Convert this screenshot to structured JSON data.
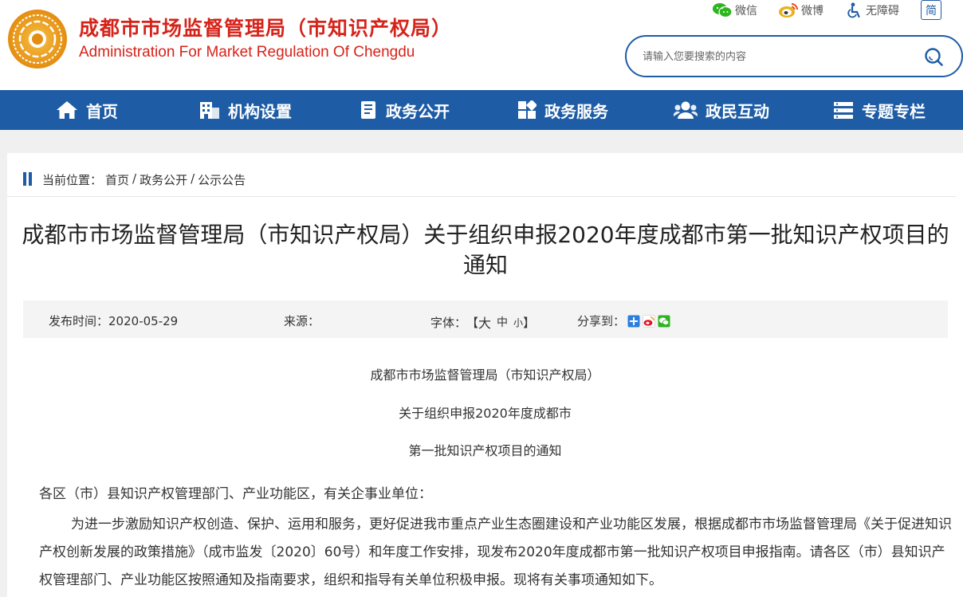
{
  "header": {
    "site_name_cn": "成都市市场监督管理局（市知识产权局）",
    "site_name_en": "Administration For Market Regulation Of Chengdu",
    "top_links": {
      "wechat": "微信",
      "weibo": "微博",
      "accessibility": "无障碍",
      "lang": "简"
    },
    "search": {
      "placeholder": "请输入您要搜索的内容"
    }
  },
  "nav": {
    "items": [
      {
        "label": "首页",
        "icon": "home-icon"
      },
      {
        "label": "机构设置",
        "icon": "building-icon"
      },
      {
        "label": "政务公开",
        "icon": "document-icon"
      },
      {
        "label": "政务服务",
        "icon": "grid-icon"
      },
      {
        "label": "政民互动",
        "icon": "people-icon"
      },
      {
        "label": "专题专栏",
        "icon": "list-icon"
      }
    ]
  },
  "breadcrumb": {
    "prefix": "当前位置：",
    "items": [
      "首页",
      "政务公开",
      "公示公告"
    ],
    "separator": "/"
  },
  "article": {
    "title": "成都市市场监督管理局（市知识产权局）关于组织申报2020年度成都市第一批知识产权项目的通知",
    "meta": {
      "date_label": "发布时间：",
      "date": "2020-05-29",
      "source_label": "来源：",
      "source": "",
      "font_label": "字体：",
      "font_open": "【",
      "font_large": "大",
      "font_medium": "中",
      "font_small": "小",
      "font_close": "】",
      "share_label": "分享到："
    },
    "heading_lines": [
      "成都市市场监督管理局（市知识产权局）",
      "关于组织申报2020年度成都市",
      "第一批知识产权项目的通知"
    ],
    "salutation": "各区（市）县知识产权管理部门、产业功能区，有关企事业单位：",
    "paragraph1": "为进一步激励知识产权创造、保护、运用和服务，更好促进我市重点产业生态圈建设和产业功能区发展，根据成都市市场监督管理局《关于促进知识产权创新发展的政策措施》（成市监发〔2020〕60号）和年度工作安排，现发布2020年度成都市第一批知识产权项目申报指南。请各区（市）县知识产权管理部门、产业功能区按照通知及指南要求，组织和指导有关单位积极申报。现将有关事项通知如下。"
  },
  "colors": {
    "brand_red": "#d6231a",
    "nav_blue": "#1e5ca5",
    "page_bg": "#f0f0f0"
  }
}
